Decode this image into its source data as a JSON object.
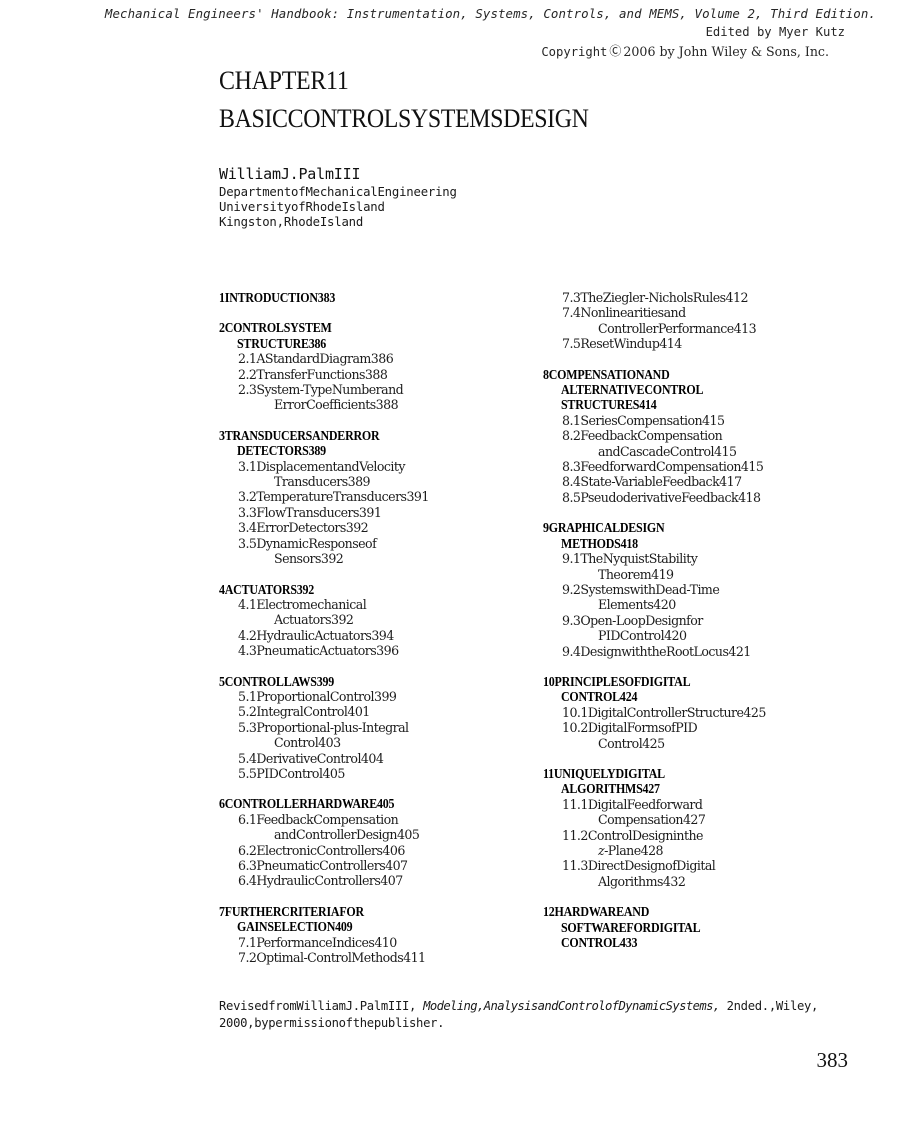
{
  "header": {
    "running_head": "Mechanical Engineers' Handbook: Instrumentation, Systems, Controls, and MEMS, Volume 2, Third Edition.",
    "edited_by": "Edited by Myer Kutz",
    "copyright_pre": "Copyright",
    "copyright_symbol": "Ⓒ",
    "copyright_post": "2006 by John Wiley & Sons, Inc."
  },
  "chapter": {
    "number_label": "CHAPTER11",
    "title": "BASICCONTROLSYSTEMSDESIGN"
  },
  "author": {
    "name": "WilliamJ.PalmIII",
    "department": "DepartmentofMechanicalEngineering",
    "institution": "UniversityofRhodeIsland",
    "location": "Kingston,RhodeIsland"
  },
  "toc": {
    "left_column": [
      {
        "heading": [
          "1INTRODUCTION383"
        ],
        "items": []
      },
      {
        "heading": [
          "2CONTROLSYSTEM",
          "STRUCTURE386"
        ],
        "items": [
          [
            "2.1AStandardDiagram386"
          ],
          [
            "2.2TransferFunctions388"
          ],
          [
            "2.3System-TypeNumberand",
            "ErrorCoefficients388"
          ]
        ]
      },
      {
        "heading": [
          "3TRANSDUCERSANDERROR",
          "DETECTORS389"
        ],
        "items": [
          [
            "3.1DisplacementandVelocity",
            "Transducers389"
          ],
          [
            "3.2TemperatureTransducers391"
          ],
          [
            "3.3FlowTransducers391"
          ],
          [
            "3.4ErrorDetectors392"
          ],
          [
            "3.5DynamicResponseof",
            "Sensors392"
          ]
        ]
      },
      {
        "heading": [
          "4ACTUATORS392"
        ],
        "items": [
          [
            "4.1Electromechanical",
            "Actuators392"
          ],
          [
            "4.2HydraulicActuators394"
          ],
          [
            "4.3PneumaticActuators396"
          ]
        ]
      },
      {
        "heading": [
          "5CONTROLLAWS399"
        ],
        "items": [
          [
            "5.1ProportionalControl399"
          ],
          [
            "5.2IntegralControl401"
          ],
          [
            "5.3Proportional-plus-Integral",
            "Control403"
          ],
          [
            "5.4DerivativeControl404"
          ],
          [
            "5.5PIDControl405"
          ]
        ]
      },
      {
        "heading": [
          "6CONTROLLERHARDWARE405"
        ],
        "items": [
          [
            "6.1FeedbackCompensation",
            "andControllerDesign405"
          ],
          [
            "6.2ElectronicControllers406"
          ],
          [
            "6.3PneumaticControllers407"
          ],
          [
            "6.4HydraulicControllers407"
          ]
        ]
      },
      {
        "heading": [
          "7FURTHERCRITERIAFOR",
          "GAINSELECTION409"
        ],
        "items": [
          [
            "7.1PerformanceIndices410"
          ],
          [
            "7.2Optimal-ControlMethods411"
          ]
        ]
      }
    ],
    "right_column": [
      {
        "heading": [],
        "items": [
          [
            "7.3TheZiegler-NicholsRules412"
          ],
          [
            "7.4Nonlinearitiesand",
            "ControllerPerformance413"
          ],
          [
            "7.5ResetWindup414"
          ]
        ]
      },
      {
        "heading": [
          "8COMPENSATIONAND",
          "ALTERNATIVECONTROL",
          "STRUCTURES414"
        ],
        "items": [
          [
            "8.1SeriesCompensation415"
          ],
          [
            "8.2FeedbackCompensation",
            "andCascadeControl415"
          ],
          [
            "8.3FeedforwardCompensation415"
          ],
          [
            "8.4State-VariableFeedback417"
          ],
          [
            "8.5PseudoderivativeFeedback418"
          ]
        ]
      },
      {
        "heading": [
          "9GRAPHICALDESIGN",
          "METHODS418"
        ],
        "items": [
          [
            "9.1TheNyquistStability",
            "Theorem419"
          ],
          [
            "9.2SystemswithDead-Time",
            "Elements420"
          ],
          [
            "9.3Open-LoopDesignfor",
            "PIDControl420"
          ],
          [
            "9.4DesignwiththeRootLocus421"
          ]
        ]
      },
      {
        "heading": [
          "10PRINCIPLESOFDIGITAL",
          "CONTROL424"
        ],
        "items": [
          [
            "10.1DigitalControllerStructure425"
          ],
          [
            "10.2DigitalFormsofPID",
            "Control425"
          ]
        ]
      },
      {
        "heading": [
          "11UNIQUELYDIGITAL",
          "ALGORITHMS427"
        ],
        "items": [
          [
            "11.1DigitalFeedforward",
            "Compensation427"
          ],
          [
            "11.2ControlDesigninthe",
            "z-Plane428"
          ],
          [
            "11.3DirectDesignofDigital",
            "Algorithms432"
          ]
        ]
      },
      {
        "heading": [
          "12HARDWAREAND",
          "SOFTWAREFORDIGITAL",
          "CONTROL433"
        ],
        "items": []
      }
    ]
  },
  "footnote": {
    "prefix": "RevisedfromWilliamJ.PalmIII,",
    "book_title": "Modeling,AnalysisandControlofDynamicSystems,",
    "suffix": "2nded.,Wiley,",
    "line2": "2000,bypermissionofthepublisher."
  },
  "page_number": "383"
}
